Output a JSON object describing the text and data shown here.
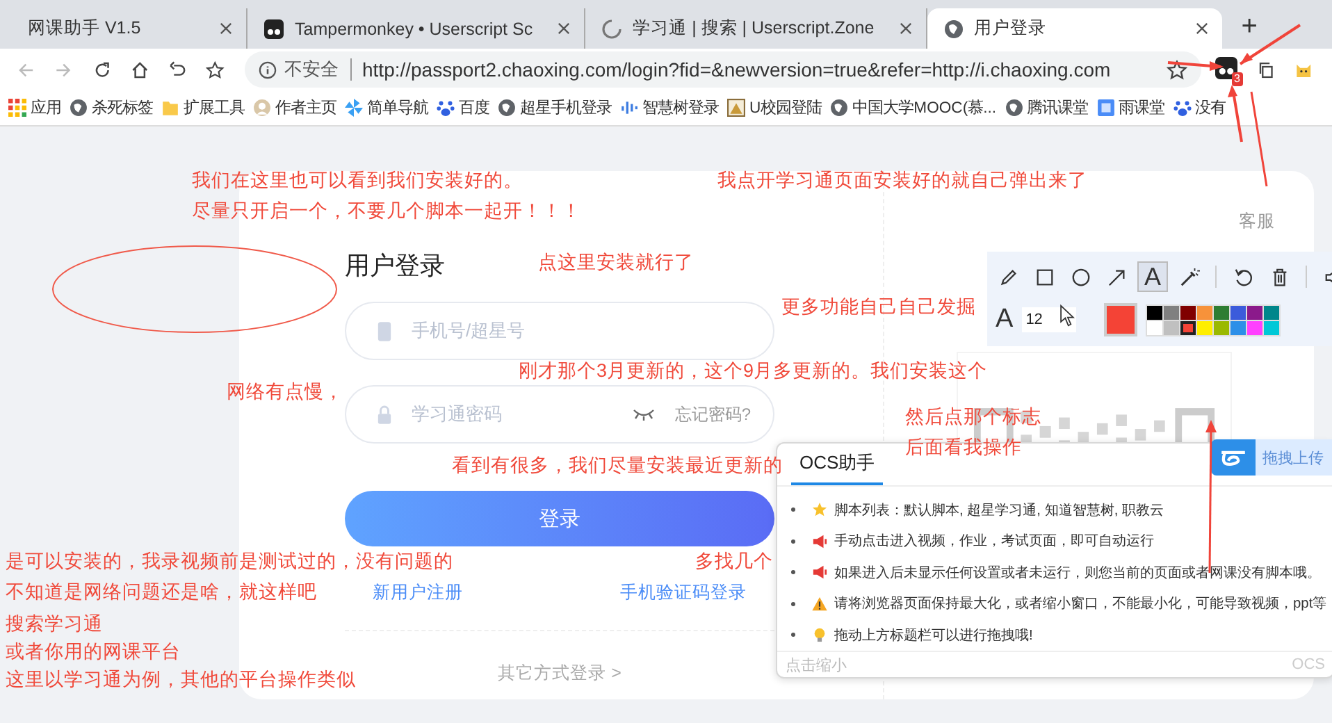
{
  "tabs": [
    {
      "title": "网课助手 V1.5",
      "kind": "plain",
      "selected": false
    },
    {
      "title": "Tampermonkey • Userscript Sc",
      "kind": "tampermonkey",
      "selected": false
    },
    {
      "title": "学习通 | 搜索 | Userscript.Zone",
      "kind": "loading",
      "selected": false
    },
    {
      "title": "用户登录",
      "kind": "globe",
      "selected": true
    }
  ],
  "new_tab": "+",
  "address_bar": {
    "security": "不安全",
    "url": "http://passport2.chaoxing.com/login?fid=&newversion=true&refer=http://i.chaoxing.com",
    "extension_badge": "3"
  },
  "bookmarks": [
    {
      "label": "应用",
      "kind": "apps"
    },
    {
      "label": "杀死标签",
      "kind": "globe"
    },
    {
      "label": "扩展工具",
      "kind": "folder"
    },
    {
      "label": "作者主页",
      "kind": "avatar"
    },
    {
      "label": "简单导航",
      "kind": "pinwheel"
    },
    {
      "label": "百度",
      "kind": "paw"
    },
    {
      "label": "超星手机登录",
      "kind": "globe"
    },
    {
      "label": "智慧树登录",
      "kind": "bars"
    },
    {
      "label": "U校园登陆",
      "kind": "image"
    },
    {
      "label": "中国大学MOOC(慕...",
      "kind": "globe"
    },
    {
      "label": "腾讯课堂",
      "kind": "globe"
    },
    {
      "label": "雨课堂",
      "kind": "square"
    },
    {
      "label": "没有",
      "kind": "paw"
    }
  ],
  "login": {
    "title": "用户登录",
    "phone_placeholder": "手机号/超星号",
    "password_placeholder": "学习通密码",
    "forgot": "忘记密码?",
    "submit": "登录",
    "register": "新用户注册",
    "sms_login": "手机验证码登录",
    "other_login": "其它方式登录 >",
    "service": "客服"
  },
  "draw_toolbar": {
    "tools": [
      {
        "kind": "pencil",
        "selected": false
      },
      {
        "kind": "rectangle",
        "selected": false
      },
      {
        "kind": "ellipse",
        "selected": false
      },
      {
        "kind": "arrow",
        "selected": false
      },
      {
        "kind": "text",
        "label": "A",
        "selected": true
      },
      {
        "kind": "wand",
        "selected": false
      }
    ],
    "actions": [
      {
        "kind": "undo"
      },
      {
        "kind": "trash"
      },
      {
        "kind": "speaker"
      }
    ],
    "font_label": "A",
    "font_size": "12",
    "swatches": [
      {
        "color": "#000000",
        "selected": false
      },
      {
        "color": "#808080",
        "selected": false
      },
      {
        "color": "#800000",
        "selected": false
      },
      {
        "color": "#f7923a",
        "selected": false
      },
      {
        "color": "#2e7d32",
        "selected": false
      },
      {
        "color": "#3b5bdb",
        "selected": false
      },
      {
        "color": "#8b1a8b",
        "selected": false
      },
      {
        "color": "#00868b",
        "selected": false
      },
      {
        "color": "#ffffff",
        "selected": false
      },
      {
        "color": "#c0c0c0",
        "selected": false
      },
      {
        "color": "#f44336",
        "selected": true
      },
      {
        "color": "#ffee00",
        "selected": false
      },
      {
        "color": "#9ab900",
        "selected": false
      },
      {
        "color": "#2d8fe8",
        "selected": false
      },
      {
        "color": "#ff40ff",
        "selected": false
      },
      {
        "color": "#00c8d7",
        "selected": false
      }
    ]
  },
  "upload_button": {
    "label": "拖拽上传"
  },
  "ocs_panel": {
    "tab": "OCS助手",
    "items": [
      {
        "kind": "star",
        "text": "脚本列表：默认脚本, 超星学习通, 知道智慧树, 职教云"
      },
      {
        "kind": "megaphone",
        "text": "手动点击进入视频，作业，考试页面，即可自动运行"
      },
      {
        "kind": "megaphone",
        "text": "如果进入后未显示任何设置或者未运行，则您当前的页面或者网课没有脚本哦。"
      },
      {
        "kind": "warning",
        "text": "请将浏览器页面保持最大化，或者缩小窗口，不能最小化，可能导致视频，ppt等"
      },
      {
        "kind": "bulb",
        "text": "拖动上方标题栏可以进行拖拽哦!"
      }
    ],
    "footer": "点击缩小",
    "footer_right": "OCS"
  },
  "annotations": [
    {
      "text": "我们在这里也可以看到我们安装好的。"
    },
    {
      "text": "尽量只开启一个，不要几个脚本一起开！！！"
    },
    {
      "text": "我点开学习通页面安装好的就自己弹出来了"
    },
    {
      "text": "点这里安装就行了"
    },
    {
      "text": "更多功能自己自己发掘"
    },
    {
      "text": "网络有点慢，"
    },
    {
      "text": "刚才那个3月更新的，这个9月多更新的。我们安装这个"
    },
    {
      "text": "然后点那个标志"
    },
    {
      "text": "后面看我操作"
    },
    {
      "text": "是可以安装的，我录视频前是测试过的，没有问题的"
    },
    {
      "text": "不知道是网络问题还是啥，就这样吧"
    },
    {
      "text": "看到有很多，我们尽量安装最近更新的"
    },
    {
      "text": "多找几个"
    },
    {
      "text": "搜索学习通"
    },
    {
      "text": "或者你用的网课平台"
    },
    {
      "text": "这里以学习通为例，其他的平台操作类似"
    }
  ]
}
